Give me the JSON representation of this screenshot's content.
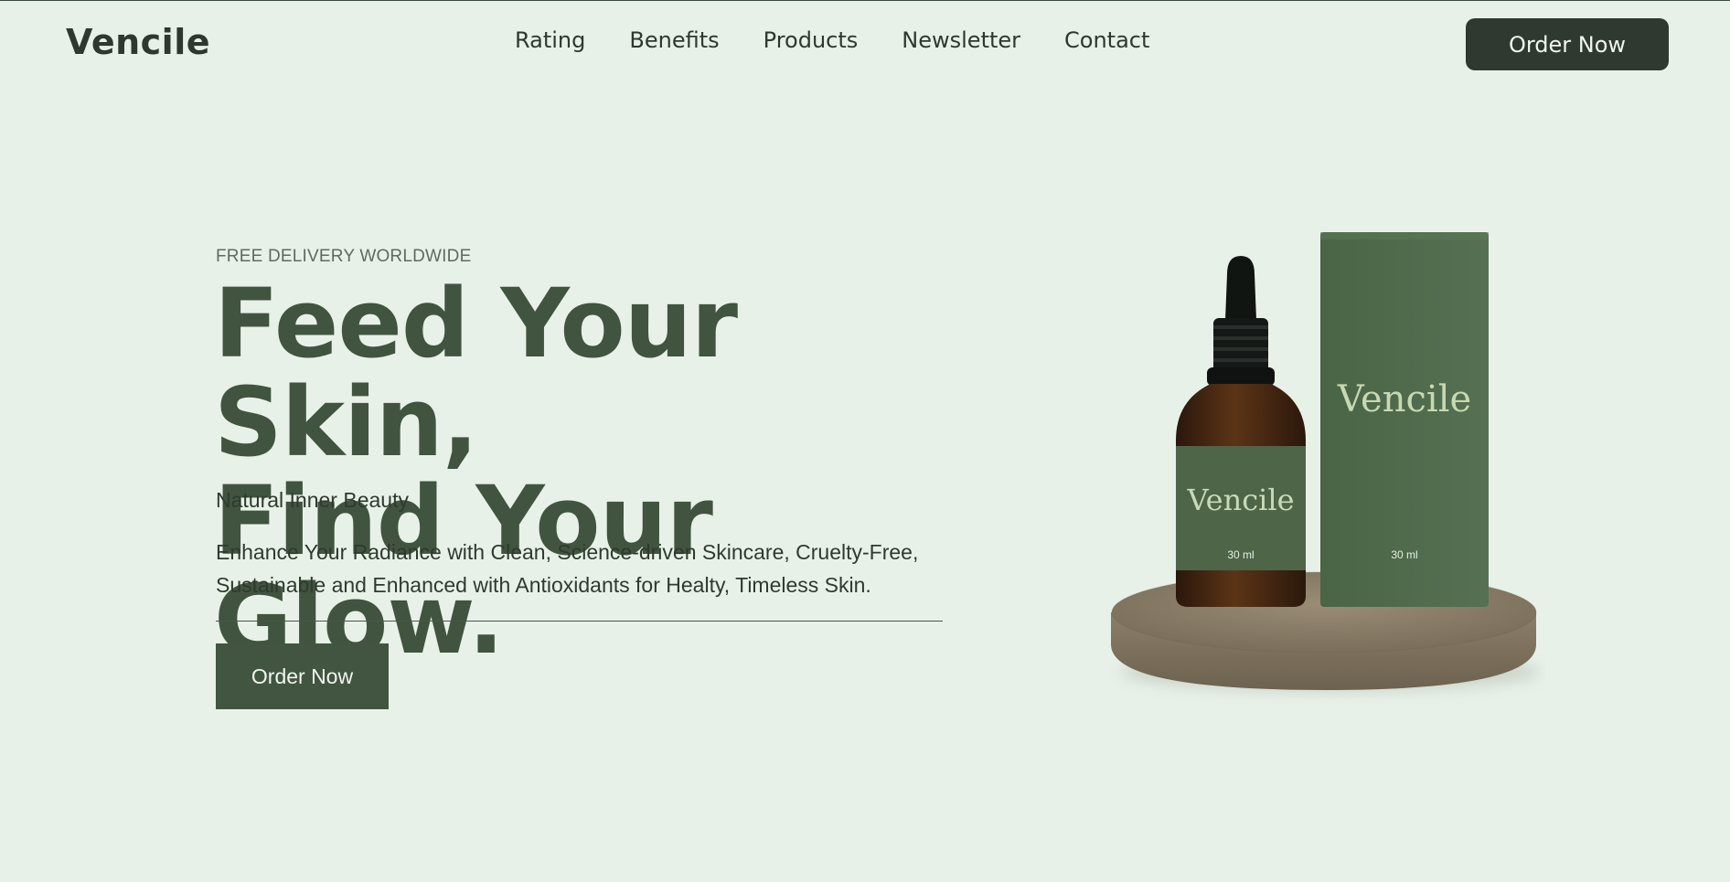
{
  "brand": {
    "name": "Vencile"
  },
  "nav": {
    "items": [
      {
        "label": "Rating"
      },
      {
        "label": "Benefits"
      },
      {
        "label": "Products"
      },
      {
        "label": "Newsletter"
      },
      {
        "label": "Contact"
      }
    ],
    "cta_label": "Order Now"
  },
  "hero": {
    "eyebrow": "FREE DELIVERY WORLDWIDE",
    "headline_line1": "Feed Your Skin,",
    "headline_line2": "Find Your Glow.",
    "subhead": "Natural Inner Beauty",
    "description_line1": "Enhance Your Radiance with Clean, Science-driven Skincare, Cruelty-Free,",
    "description_line2": "Sustainable and Enhanced with Antioxidants for Healty, Timeless Skin.",
    "cta_label": "Order Now"
  },
  "product": {
    "bottle_label": "Vencile",
    "bottle_volume": "30 ml",
    "box_label": "Vencile",
    "box_volume": "30 ml"
  },
  "colors": {
    "background": "#e8f1e8",
    "primary_green": "#415540",
    "dark_button": "#2f392f",
    "box_green": "#4f6a4a",
    "stone": "#8a7c66"
  }
}
